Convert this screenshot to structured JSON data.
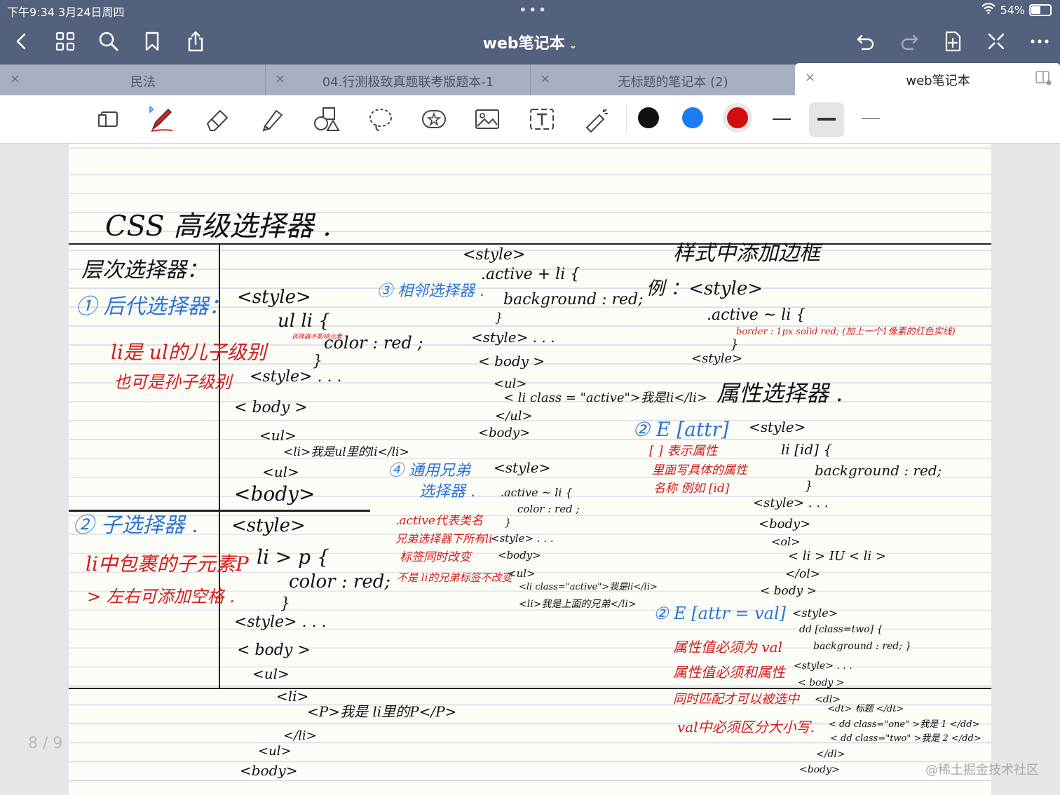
{
  "status": {
    "time": "下午9:34   3月24日周四",
    "dots": "•••",
    "battery_pct": "54%",
    "battery_level": 0.54
  },
  "nav": {
    "title": "web笔记本",
    "left_icons": [
      "back-icon",
      "grid-icon",
      "search-icon",
      "bookmark-icon",
      "share-icon"
    ],
    "right_icons": [
      "undo-icon",
      "redo-icon",
      "add-page-icon",
      "close-cross-icon",
      "more-icon"
    ]
  },
  "tabs": [
    {
      "label": "民法",
      "close": "×"
    },
    {
      "label": "04.行测极致真题联考版题本-1",
      "close": "×"
    },
    {
      "label": "无标题的笔记本 (2)",
      "close": "×"
    },
    {
      "label": "web笔记本",
      "close": "×",
      "active": true
    }
  ],
  "toolbar": {
    "tools": [
      "read-mode-icon",
      "pen-icon",
      "eraser-icon",
      "highlighter-icon",
      "shapes-icon",
      "lasso-icon",
      "sticker-icon",
      "image-icon",
      "text-icon",
      "laser-pointer-icon"
    ],
    "colors": [
      "#111111",
      "#1a7cf0",
      "#d20f0f"
    ],
    "selected_color": "#d20f0f"
  },
  "page": {
    "indicator": "8 / 9",
    "watermark": "@稀土掘金技术社区"
  },
  "notes": {
    "title": "CSS 高级选择器 .",
    "level_selector": "层次选择器：",
    "desc_selector": "① 后代选择器：",
    "desc_code": [
      "<style>",
      "ul  li {",
      "color : red ;",
      "}",
      "<style> . . .",
      "< body >",
      "<ul>",
      "<li>我是ul里的li</li>",
      "<ul>",
      "<body>"
    ],
    "desc_note1": "li是 ul的儿子级别",
    "desc_note2": "也可是孙子级别",
    "desc_small": "选择器不影响元素",
    "child_selector": "② 子选择器 .",
    "child_note1": "li中包裹的子元素P",
    "child_note2": "> 左右可添加空格 .",
    "child_code": [
      "<style>",
      "li > p {",
      "color : red;",
      "}",
      "<style> . . .",
      "< body >",
      "<ul>",
      "<li>",
      "<P>我是 li里的P</P>",
      "</li>",
      "<ul>",
      "<body>"
    ],
    "adj_selector": "③ 相邻选择器 .",
    "adj_code": [
      "<style>",
      ".active + li {",
      "background : red;",
      "}",
      "<style> . . .",
      "< body >",
      "<ul>",
      "< li  class = \"active\">我是li</li>",
      "</ul>",
      "<body>"
    ],
    "gen_selector1": "④ 通用兄弟",
    "gen_selector2": "选择器 .",
    "gen_code": [
      "<style>",
      ".active ~ li {",
      "color : red ;",
      "}",
      "<style> . . .",
      "<body>",
      "<ul>",
      "<li  class=\"active\">我是li</li>",
      "<li>我是上面的兄弟</li>"
    ],
    "gen_note1": ".active代表类名",
    "gen_note2": "兄弟选择器下所有li",
    "gen_note3": "标签同时改变",
    "gen_note4": "不是 li的兄弟标签不改变",
    "border_title": "样式中添加边框",
    "border_code": [
      "例 ：<style>",
      ".active ~ li {",
      "}",
      "<style>"
    ],
    "border_css": "border : 1px  solid  red;   (加上一个1像素的红色实线)",
    "attr_title": "属性选择器 .",
    "attr1": "② E [attr]",
    "attr1_note1": "[ ] 表示属性",
    "attr1_note2": "里面写具体的属性",
    "attr1_note3": "名称  例如 [id]",
    "attr1_code": [
      "<style>",
      "li [id] {",
      "background : red;",
      "}",
      "<style> . . .",
      "<body>",
      "<ol>",
      "< li > IU < li >",
      "</ol>",
      "< body >"
    ],
    "attr2": "② E [attr = val]",
    "attr2_note1": "属性值必须为 val",
    "attr2_note2": "属性值必须和属性",
    "attr2_note3": "同时匹配才可以被选中",
    "attr2_note4": "val中必须区分大小写.",
    "attr2_code": [
      "<style>",
      "dd [class=two] {",
      "background : red; }",
      "<style> . . .",
      "< body >",
      "<dl>",
      "<dt> 标题 </dt>",
      "< dd  class=\"one\" >我是 1 </dd>",
      "< dd  class=\"two\" >我是 2 </dd>",
      "</dl>",
      "<body>"
    ]
  }
}
